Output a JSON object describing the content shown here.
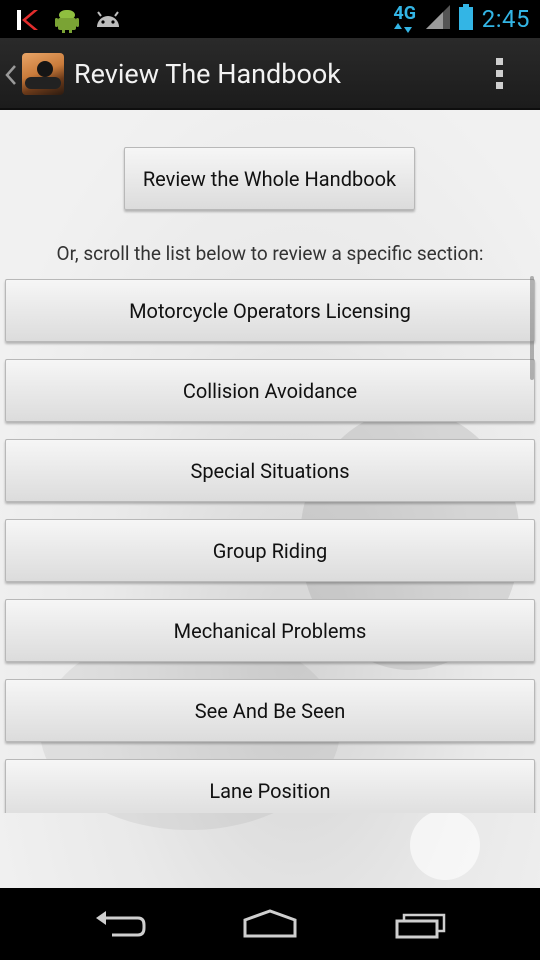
{
  "status_bar": {
    "time": "2:45",
    "network": "4G",
    "icons": [
      "kaspersky-k-icon",
      "android-robot-icon",
      "android-debug-icon",
      "network-4g-icon",
      "signal-icon",
      "battery-icon"
    ]
  },
  "action_bar": {
    "title": "Review The Handbook",
    "icons": [
      "up-chevron-icon",
      "app-icon",
      "overflow-menu-icon"
    ]
  },
  "main": {
    "whole_button_label": "Review the Whole Handbook",
    "instructions": "Or, scroll the list below to review a specific section:",
    "sections": [
      {
        "label": "Motorcycle Operators Licensing"
      },
      {
        "label": "Collision Avoidance"
      },
      {
        "label": "Special Situations"
      },
      {
        "label": "Group Riding"
      },
      {
        "label": "Mechanical Problems"
      },
      {
        "label": "See And Be Seen"
      },
      {
        "label": "Lane Position"
      }
    ]
  },
  "nav_bar": {
    "icons": [
      "back-icon",
      "home-icon",
      "recent-apps-icon"
    ]
  },
  "colors": {
    "accent": "#33b5e5",
    "action_bar": "#222222",
    "content_bg": "#eeeeee"
  }
}
